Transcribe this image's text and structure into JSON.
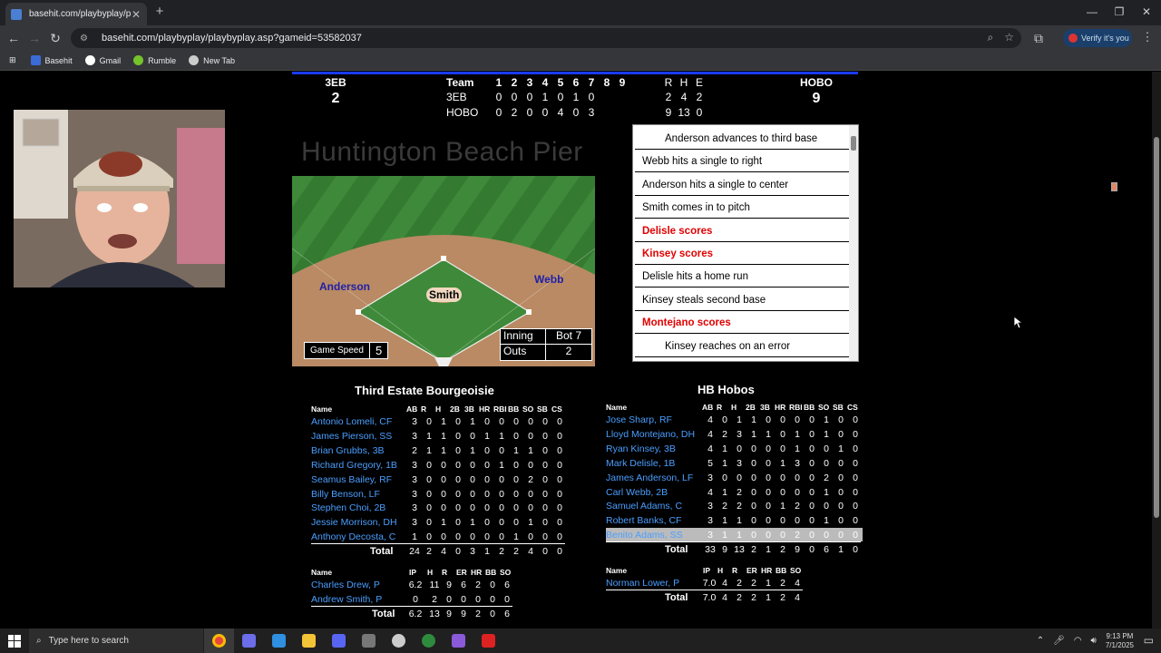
{
  "browser": {
    "tab_title": "basehit.com/playbyplay/playbyplay",
    "url": "basehit.com/playbyplay/playbyplay.asp?gameid=53582037",
    "verify_label": "Verify it's you",
    "bookmarks": [
      {
        "label": "Basehit",
        "icon": "basehit-icon",
        "color": "#3b6bd6"
      },
      {
        "label": "Gmail",
        "icon": "google-icon",
        "color": "#ffffff"
      },
      {
        "label": "Rumble",
        "icon": "rumble-icon",
        "color": "#74c32b"
      },
      {
        "label": "New Tab",
        "icon": "globe-icon",
        "color": "#cccccc"
      }
    ]
  },
  "score": {
    "away_abbr": "3EB",
    "away_runs": "2",
    "home_abbr": "HOBO",
    "home_runs": "9",
    "team_header": "Team",
    "innings": [
      "1",
      "2",
      "3",
      "4",
      "5",
      "6",
      "7",
      "8",
      "9"
    ],
    "rhe_headers": [
      "R",
      "H",
      "E"
    ],
    "away_line": {
      "name": "3EB",
      "innings": [
        "0",
        "0",
        "0",
        "1",
        "0",
        "1",
        "0",
        "",
        ""
      ],
      "rhe": [
        "2",
        "4",
        "2"
      ]
    },
    "home_line": {
      "name": "HOBO",
      "innings": [
        "0",
        "2",
        "0",
        "0",
        "4",
        "0",
        "3",
        "",
        ""
      ],
      "rhe": [
        "9",
        "13",
        "0"
      ]
    }
  },
  "field": {
    "venue": "Huntington Beach Pier",
    "runner_third": "Anderson",
    "runner_first": "Webb",
    "pitcher": "Smith",
    "game_speed_label": "Game Speed",
    "game_speed_value": "5",
    "inning_label": "Inning",
    "inning_value": "Bot 7",
    "outs_label": "Outs",
    "outs_value": "2"
  },
  "play_by_play": [
    {
      "text": "Anderson advances to third base",
      "style": "indent"
    },
    {
      "text": "Webb hits a single to right",
      "style": "normal"
    },
    {
      "text": "Anderson hits a single to center",
      "style": "normal"
    },
    {
      "text": "Smith comes in to pitch",
      "style": "normal"
    },
    {
      "text": "Delisle scores",
      "style": "red"
    },
    {
      "text": "Kinsey scores",
      "style": "red"
    },
    {
      "text": "Delisle hits a home run",
      "style": "normal"
    },
    {
      "text": "Kinsey steals second base",
      "style": "normal"
    },
    {
      "text": "Montejano scores",
      "style": "red"
    },
    {
      "text": "Kinsey reaches on an error",
      "style": "indent"
    }
  ],
  "batting_headers": [
    "Name",
    "AB",
    "R",
    "H",
    "2B",
    "3B",
    "HR",
    "RBI",
    "BB",
    "SO",
    "SB",
    "CS"
  ],
  "pitching_headers": [
    "Name",
    "IP",
    "H",
    "R",
    "ER",
    "HR",
    "BB",
    "SO"
  ],
  "away_box": {
    "team_name": "Third Estate Bourgeoisie",
    "batters": [
      {
        "name": "Antonio Lomeli, CF",
        "stats": [
          "3",
          "0",
          "1",
          "0",
          "1",
          "0",
          "0",
          "0",
          "0",
          "0",
          "0"
        ]
      },
      {
        "name": "James Pierson, SS",
        "stats": [
          "3",
          "1",
          "1",
          "0",
          "0",
          "1",
          "1",
          "0",
          "0",
          "0",
          "0"
        ]
      },
      {
        "name": "Brian Grubbs, 3B",
        "stats": [
          "2",
          "1",
          "1",
          "0",
          "1",
          "0",
          "0",
          "1",
          "1",
          "0",
          "0"
        ]
      },
      {
        "name": "Richard Gregory, 1B",
        "stats": [
          "3",
          "0",
          "0",
          "0",
          "0",
          "0",
          "1",
          "0",
          "0",
          "0",
          "0"
        ]
      },
      {
        "name": "Seamus Bailey, RF",
        "stats": [
          "3",
          "0",
          "0",
          "0",
          "0",
          "0",
          "0",
          "0",
          "2",
          "0",
          "0"
        ]
      },
      {
        "name": "Billy Benson, LF",
        "stats": [
          "3",
          "0",
          "0",
          "0",
          "0",
          "0",
          "0",
          "0",
          "0",
          "0",
          "0"
        ]
      },
      {
        "name": "Stephen Choi, 2B",
        "stats": [
          "3",
          "0",
          "0",
          "0",
          "0",
          "0",
          "0",
          "0",
          "0",
          "0",
          "0"
        ]
      },
      {
        "name": "Jessie Morrison, DH",
        "stats": [
          "3",
          "0",
          "1",
          "0",
          "1",
          "0",
          "0",
          "0",
          "1",
          "0",
          "0"
        ]
      },
      {
        "name": "Anthony Decosta, C",
        "stats": [
          "1",
          "0",
          "0",
          "0",
          "0",
          "0",
          "0",
          "1",
          "0",
          "0",
          "0"
        ]
      }
    ],
    "batting_total_label": "Total",
    "batting_total": [
      "24",
      "2",
      "4",
      "0",
      "3",
      "1",
      "2",
      "2",
      "4",
      "0",
      "0"
    ],
    "pitchers": [
      {
        "name": "Charles Drew, P",
        "stats": [
          "6.2",
          "11",
          "9",
          "6",
          "2",
          "0",
          "6"
        ]
      },
      {
        "name": "Andrew Smith, P",
        "stats": [
          "0",
          "2",
          "0",
          "0",
          "0",
          "0",
          "0"
        ]
      }
    ],
    "pitching_total_label": "Total",
    "pitching_total": [
      "6.2",
      "13",
      "9",
      "9",
      "2",
      "0",
      "6"
    ]
  },
  "home_box": {
    "team_name": "HB Hobos",
    "batters": [
      {
        "name": "Jose Sharp, RF",
        "stats": [
          "4",
          "0",
          "1",
          "1",
          "0",
          "0",
          "0",
          "0",
          "1",
          "0",
          "0"
        ]
      },
      {
        "name": "Lloyd Montejano, DH",
        "stats": [
          "4",
          "2",
          "3",
          "1",
          "1",
          "0",
          "1",
          "0",
          "1",
          "0",
          "0"
        ]
      },
      {
        "name": "Ryan Kinsey, 3B",
        "stats": [
          "4",
          "1",
          "0",
          "0",
          "0",
          "0",
          "1",
          "0",
          "0",
          "1",
          "0"
        ]
      },
      {
        "name": "Mark Delisle, 1B",
        "stats": [
          "5",
          "1",
          "3",
          "0",
          "0",
          "1",
          "3",
          "0",
          "0",
          "0",
          "0"
        ]
      },
      {
        "name": "James Anderson, LF",
        "stats": [
          "3",
          "0",
          "0",
          "0",
          "0",
          "0",
          "0",
          "0",
          "2",
          "0",
          "0"
        ]
      },
      {
        "name": "Carl Webb, 2B",
        "stats": [
          "4",
          "1",
          "2",
          "0",
          "0",
          "0",
          "0",
          "0",
          "1",
          "0",
          "0"
        ]
      },
      {
        "name": "Samuel Adams, C",
        "stats": [
          "3",
          "2",
          "2",
          "0",
          "0",
          "1",
          "2",
          "0",
          "0",
          "0",
          "0"
        ]
      },
      {
        "name": "Robert Banks, CF",
        "stats": [
          "3",
          "1",
          "1",
          "0",
          "0",
          "0",
          "0",
          "0",
          "1",
          "0",
          "0"
        ]
      },
      {
        "name": "Benito Adams, SS",
        "stats": [
          "3",
          "1",
          "1",
          "0",
          "0",
          "0",
          "2",
          "0",
          "0",
          "0",
          "0"
        ],
        "highlight": true
      }
    ],
    "batting_total_label": "Total",
    "batting_total": [
      "33",
      "9",
      "13",
      "2",
      "1",
      "2",
      "9",
      "0",
      "6",
      "1",
      "0"
    ],
    "pitchers": [
      {
        "name": "Norman Lower, P",
        "stats": [
          "7.0",
          "4",
          "2",
          "2",
          "1",
          "2",
          "4"
        ]
      }
    ],
    "pitching_total_label": "Total",
    "pitching_total": [
      "7.0",
      "4",
      "2",
      "2",
      "1",
      "2",
      "4"
    ]
  },
  "taskbar": {
    "search_placeholder": "Type here to search",
    "time": "9:13 PM",
    "date": "7/1/2025",
    "pinned": [
      {
        "name": "chrome-icon",
        "color": "#e8453c"
      },
      {
        "name": "copilot-icon",
        "color": "#6b6ee8"
      },
      {
        "name": "store-icon",
        "color": "#2f8fe0"
      },
      {
        "name": "file-explorer-icon",
        "color": "#f3c338"
      },
      {
        "name": "discord-icon",
        "color": "#5865f2"
      },
      {
        "name": "calculator-icon",
        "color": "#777777"
      },
      {
        "name": "soccer-ball-icon",
        "color": "#cccccc"
      },
      {
        "name": "app-24-icon",
        "color": "#2e8b3e"
      },
      {
        "name": "copilot-plus-icon",
        "color": "#8a5ad8"
      },
      {
        "name": "app-red-icon",
        "color": "#d22"
      }
    ]
  }
}
